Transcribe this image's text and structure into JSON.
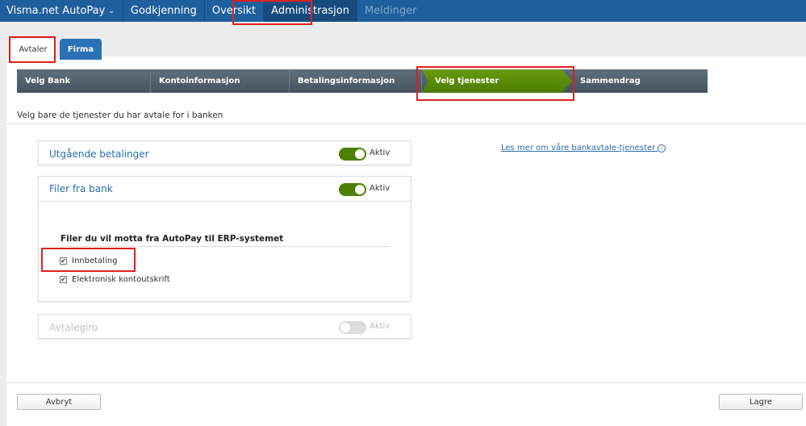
{
  "nav": {
    "brand": "Visma.net AutoPay",
    "items": [
      "Godkjenning",
      "Oversikt",
      "Administrasjon",
      "Meldinger"
    ]
  },
  "tabs": [
    "Avtaler",
    "Firma"
  ],
  "wizard": [
    "Velg Bank",
    "Kontoinformasjon",
    "Betalingsinformasjon",
    "Velg tjenester",
    "Sammendrag"
  ],
  "intro": "Velg bare de tjenester du har avtale for i banken",
  "cards": [
    {
      "title": "Utgående betalinger",
      "status": "Aktiv"
    },
    {
      "title": "Filer fra bank",
      "status": "Aktiv"
    },
    {
      "title": "Avtalegiro",
      "status": "Aktiv"
    }
  ],
  "files": {
    "heading": "Filer du vil motta fra AutoPay til ERP-systemet",
    "options": [
      "Innbetaling",
      "Elektronisk kontoutskrift"
    ]
  },
  "link": "Les mer om våre bankavtale-tjenester",
  "buttons": {
    "cancel": "Avbryt",
    "save": "Lagre"
  }
}
